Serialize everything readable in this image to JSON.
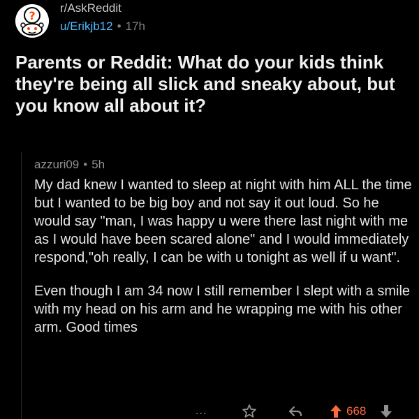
{
  "post": {
    "subreddit": "r/AskReddit",
    "author": "u/Erikjb12",
    "separator": "•",
    "age": "17h",
    "avatar_glyph": "?",
    "title": "Parents or Reddit: What do your kids think they're being all slick and sneaky about, but you know all about it?"
  },
  "comment": {
    "author": "azzuri09",
    "separator": "•",
    "age": "5h",
    "paragraph_1": "My dad knew I wanted to sleep at night with him ALL the time but I wanted to be big boy and not say it out loud. So he would say \"man, I was happy u were there last night with me as I would have been scared alone\" and I would immediately respond,\"oh really, I can be with u tonight as well if u want\".",
    "paragraph_2": "Even though I am 34 now I still remember I slept with a smile with my head on his arm and he wrapping me with his other arm. Good times"
  },
  "actions": {
    "more_label": "...",
    "score": "668"
  },
  "icons": {
    "avatar": "snoo-question-icon",
    "more": "more-options-icon",
    "award": "award-icon",
    "reply": "reply-icon",
    "upvote": "upvote-arrow-icon",
    "downvote": "downvote-arrow-icon"
  },
  "colors": {
    "background": "#000000",
    "username": "#4fbcff",
    "upvoted": "#ff6a3d",
    "muted": "#8e9091",
    "text": "#e6e6e6"
  }
}
